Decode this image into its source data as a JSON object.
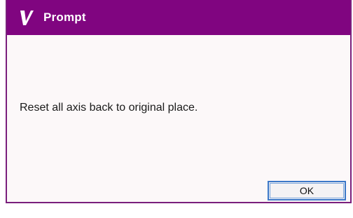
{
  "window": {
    "title": "Prompt",
    "icon": "v-logo-icon",
    "title_color": "#800580"
  },
  "dialog": {
    "message": "Reset all axis back to original place.",
    "ok_label": "OK",
    "accent": "#3c78c8"
  }
}
